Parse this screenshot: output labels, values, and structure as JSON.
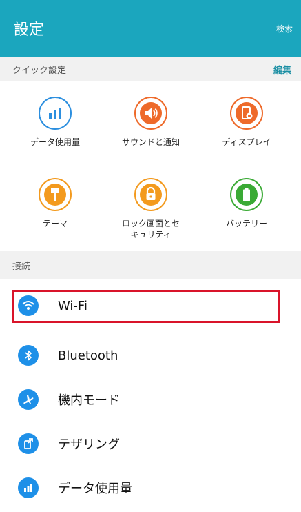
{
  "header": {
    "title": "設定",
    "search_label": "検索"
  },
  "quick_section": {
    "label": "クイック設定",
    "edit_label": "編集",
    "tiles": [
      {
        "label": "データ使用量",
        "icon": "data-usage-icon",
        "color": "#2c8fdf"
      },
      {
        "label": "サウンドと通知",
        "icon": "volume-icon",
        "color": "#ee6a2a"
      },
      {
        "label": "ディスプレイ",
        "icon": "display-settings-icon",
        "color": "#ee6a2a"
      },
      {
        "label": "テーマ",
        "icon": "theme-brush-icon",
        "color": "#f39a1e"
      },
      {
        "label": "ロック画面とセ\nキュリティ",
        "icon": "lock-icon",
        "color": "#f39a1e"
      },
      {
        "label": "バッテリー",
        "icon": "battery-icon",
        "color": "#3aaa35"
      }
    ]
  },
  "connection_section": {
    "label": "接続",
    "items": [
      {
        "label": "Wi-Fi",
        "icon": "wifi-icon"
      },
      {
        "label": "Bluetooth",
        "icon": "bluetooth-icon"
      },
      {
        "label": "機内モード",
        "icon": "airplane-icon"
      },
      {
        "label": "テザリング",
        "icon": "tethering-icon"
      },
      {
        "label": "データ使用量",
        "icon": "data-usage-icon"
      }
    ]
  },
  "colors": {
    "accent": "#1ba6be",
    "list_icon_bg": "#1e90e8",
    "highlight_border": "#d9142a"
  }
}
